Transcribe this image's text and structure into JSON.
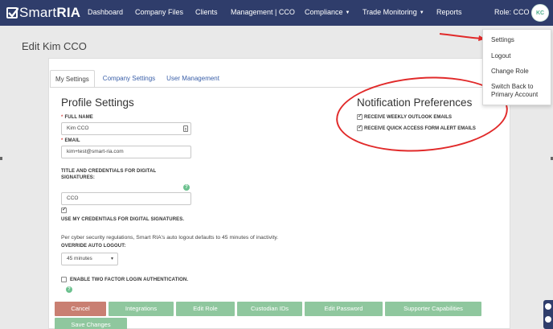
{
  "nav": {
    "logo_light": "Smart",
    "logo_bold": "RIA",
    "items": [
      "Dashboard",
      "Company Files",
      "Clients",
      "Management | CCO",
      "Compliance",
      "Trade Monitoring",
      "Reports"
    ],
    "role_label": "Role: CCO",
    "avatar_initials": "KC"
  },
  "page": {
    "title": "Edit Kim CCO"
  },
  "tabs": [
    "My Settings",
    "Company Settings",
    "User Management"
  ],
  "profile": {
    "heading": "Profile Settings",
    "full_name_label": "FULL NAME",
    "full_name_value": "Kim CCO",
    "email_label": "EMAIL",
    "email_value": "kim+test@smart-ria.com",
    "title_label_line1": "TITLE AND CREDENTIALS FOR DIGITAL",
    "title_label_line2": "SIGNATURES:",
    "title_value": "CCO",
    "help_glyph": "?",
    "use_credentials_label": "USE MY CREDENTIALS FOR DIGITAL SIGNATURES.",
    "use_credentials_checked": true,
    "logout_note": "Per cyber security regulations, Smart RIA's auto logout defaults to 45 minutes of inactivity.",
    "override_label": "OVERRIDE AUTO LOGOUT:",
    "override_value": "45 minutes",
    "two_factor_label": "ENABLE TWO FACTOR LOGIN AUTHENTICATION.",
    "two_factor_checked": false
  },
  "notifications": {
    "heading": "Notification Preferences",
    "weekly_label": "RECEIVE WEEKLY OUTLOOK EMAILS",
    "weekly_checked": true,
    "quick_label": "RECEIVE QUICK ACCESS FORM ALERT EMAILS",
    "quick_checked": true
  },
  "buttons": {
    "cancel": "Cancel",
    "integrations": "Integrations",
    "edit_role": "Edit Role",
    "custodian_ids": "Custodian IDs",
    "edit_password": "Edit Password",
    "supporter_capabilities": "Supporter Capabilities",
    "save_changes": "Save Changes"
  },
  "user_menu": {
    "settings": "Settings",
    "logout": "Logout",
    "change_role": "Change Role",
    "switch_back_line1": "Switch Back to",
    "switch_back_line2": "Primary Account"
  },
  "colors": {
    "nav_bg": "#2f3d6b",
    "button_green": "#8fc79e",
    "button_cancel": "#c97f72",
    "annotation_red": "#e12a2a",
    "help_green": "#6cc18f"
  }
}
